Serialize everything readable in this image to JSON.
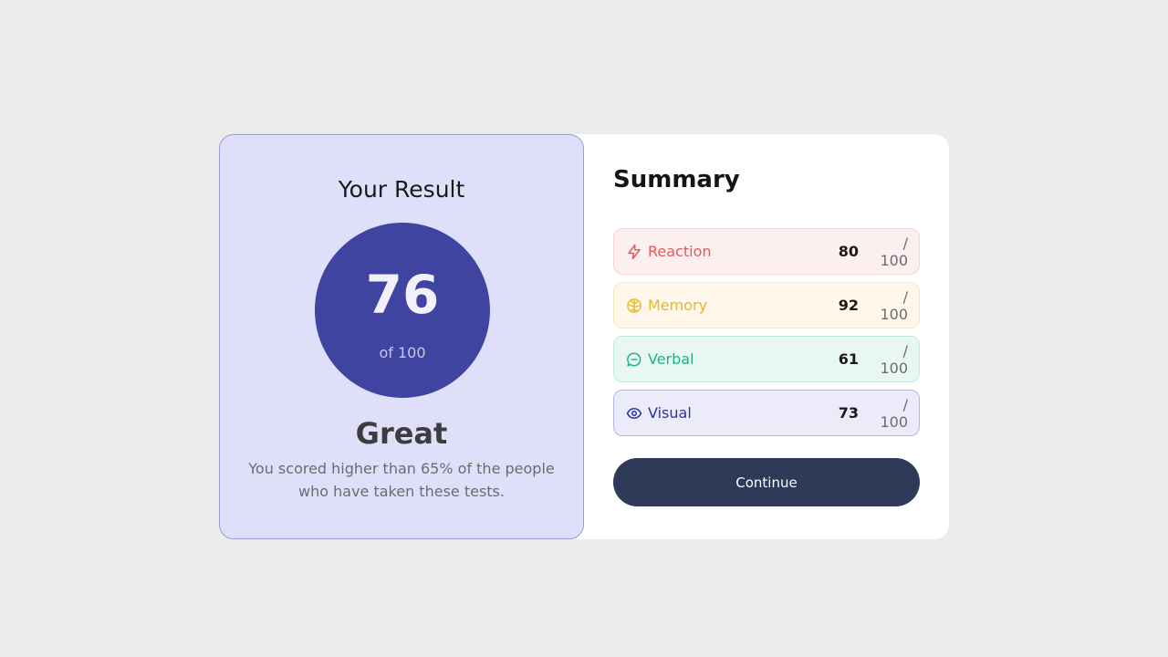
{
  "result": {
    "title": "Your Result",
    "score": "76",
    "score_of": "of 100",
    "rating": "Great",
    "description": "You scored higher than 65% of the people who have taken these tests."
  },
  "summary": {
    "title": "Summary",
    "items": [
      {
        "label": "Reaction",
        "score": "80",
        "max": "/ 100",
        "icon": "lightning-icon",
        "color": "#e45a5a",
        "bg": "#fcefef",
        "border": "#f6d4d4"
      },
      {
        "label": "Memory",
        "score": "92",
        "max": "/ 100",
        "icon": "brain-icon",
        "color": "#e8b627",
        "bg": "#fff8ea",
        "border": "#f8e8c2"
      },
      {
        "label": "Verbal",
        "score": "61",
        "max": "/ 100",
        "icon": "chat-icon",
        "color": "#1fb386",
        "bg": "#e9f7f3",
        "border": "#bfe8dc"
      },
      {
        "label": "Visual",
        "score": "73",
        "max": "/ 100",
        "icon": "eye-icon",
        "color": "#2a32a8",
        "bg": "#ebebfa",
        "border": "#b5b6e6"
      }
    ]
  },
  "continue_label": "Continue",
  "colors": {
    "accent": "#3e44a0",
    "button": "#2f3958",
    "result_bg": "#e0dffa"
  }
}
